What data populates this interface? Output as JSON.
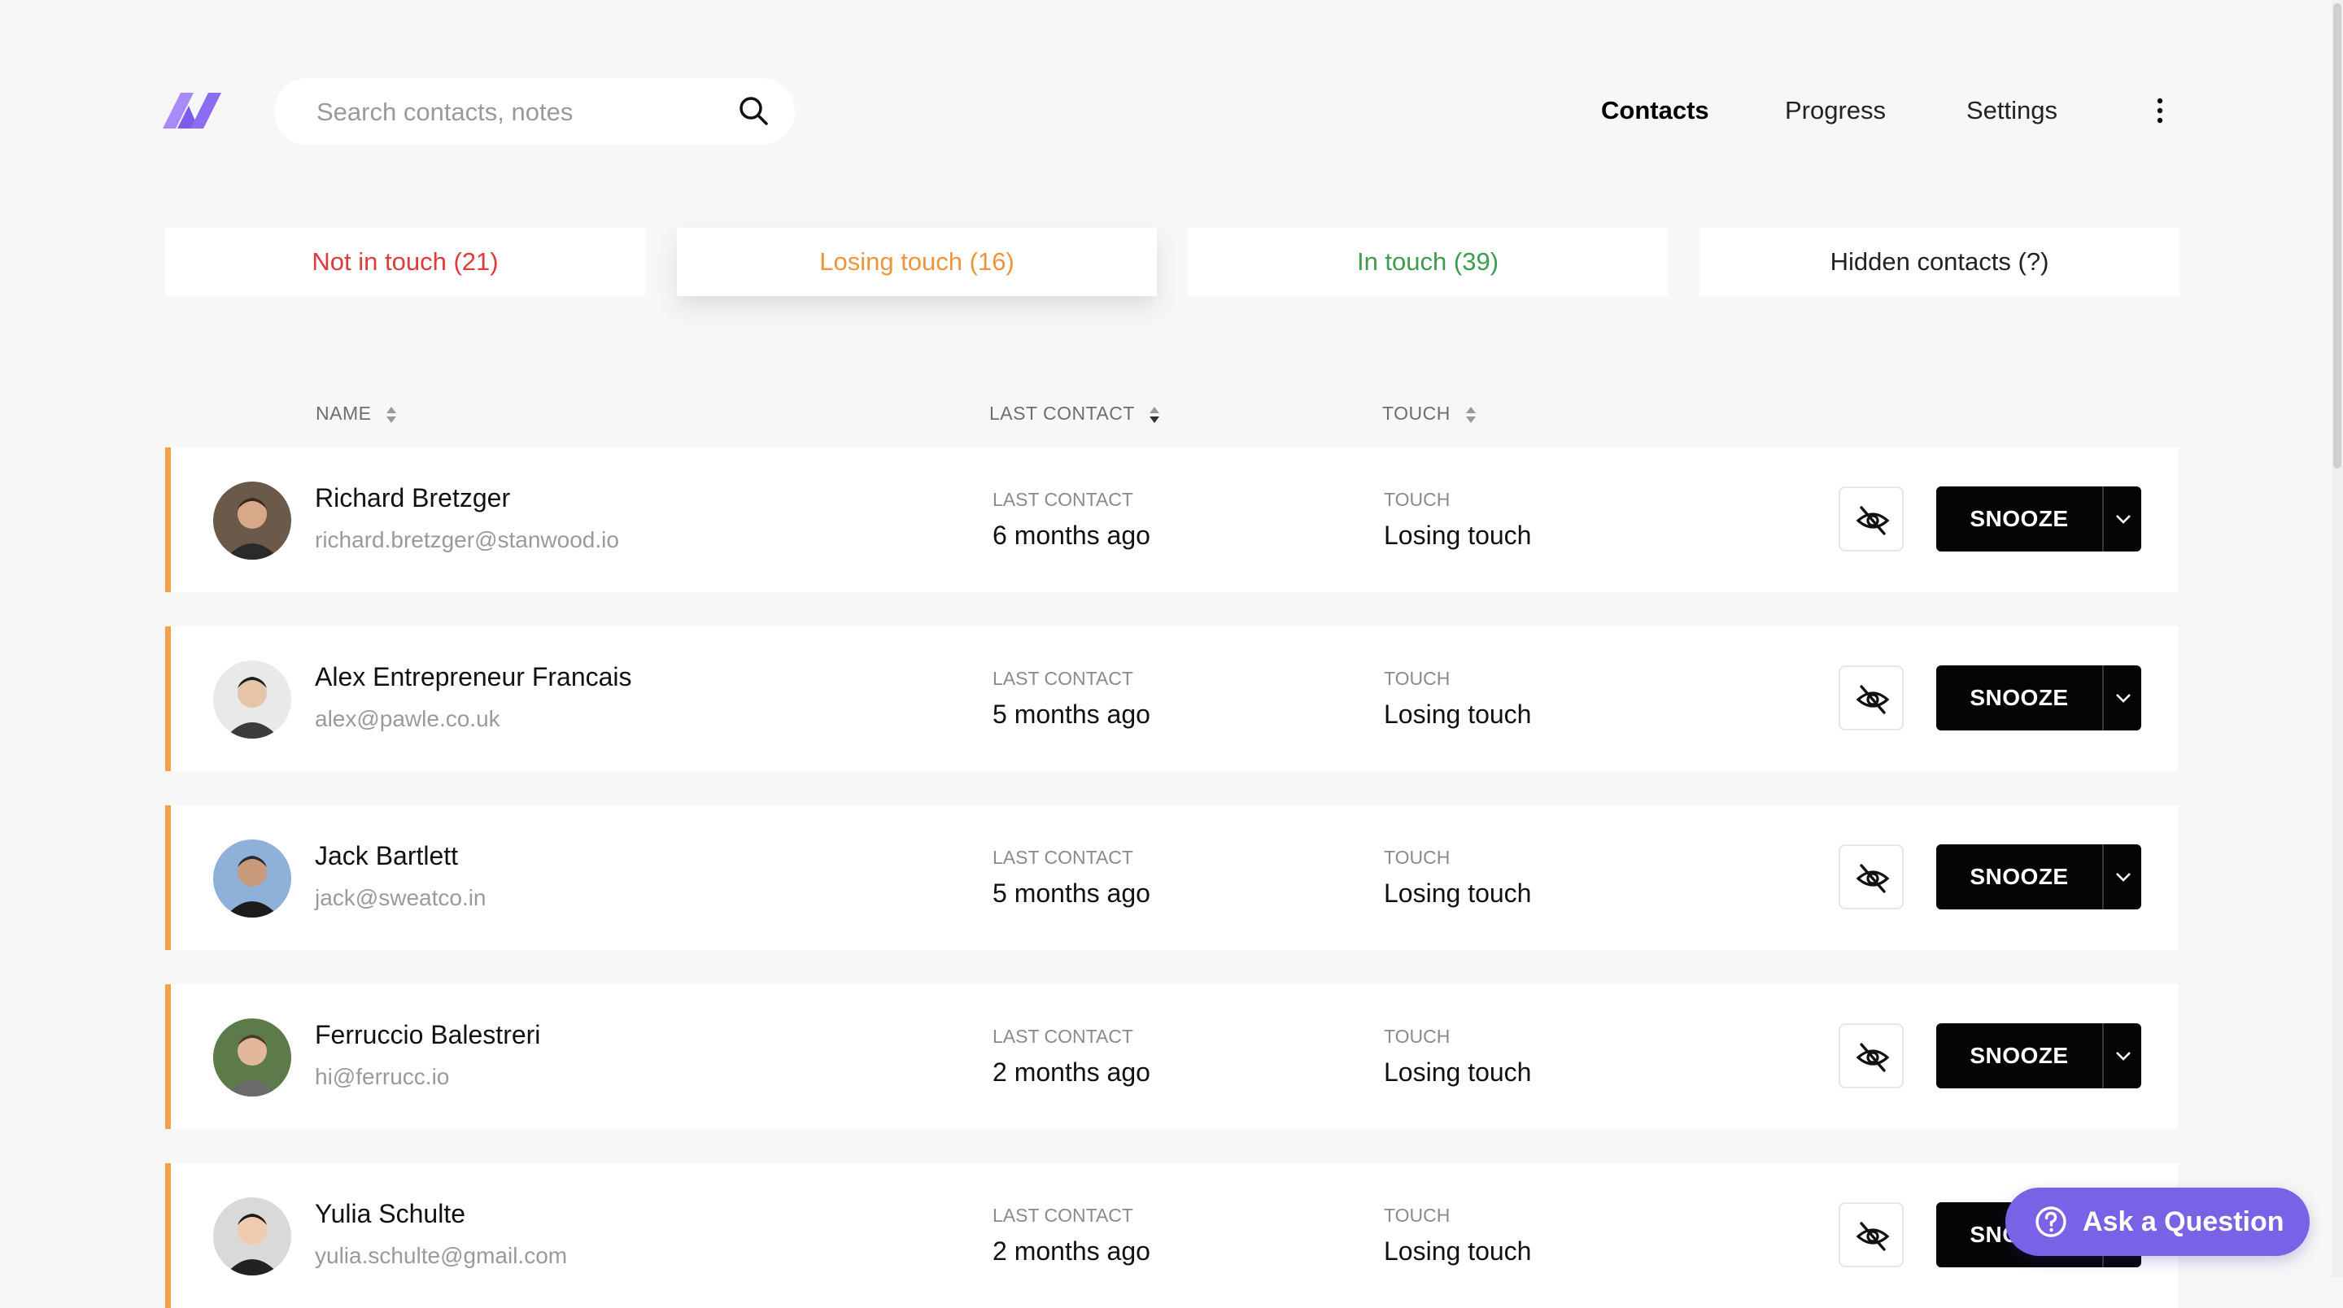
{
  "header": {
    "search_placeholder": "Search contacts, notes",
    "nav": {
      "contacts": "Contacts",
      "progress": "Progress",
      "settings": "Settings"
    },
    "active_nav": "Contacts"
  },
  "tabs": {
    "not_in_touch": "Not in touch (21)",
    "losing_touch": "Losing touch (16)",
    "in_touch": "In touch (39)",
    "hidden": "Hidden contacts (?)",
    "active": "losing_touch"
  },
  "columns": {
    "name": "NAME",
    "last_contact": "LAST CONTACT",
    "touch": "TOUCH"
  },
  "row_labels": {
    "last_contact": "LAST CONTACT",
    "touch": "TOUCH",
    "snooze": "SNOOZE"
  },
  "contacts": [
    {
      "name": "Richard Bretzger",
      "email": "richard.bretzger@stanwood.io",
      "last_contact": "6 months ago",
      "touch": "Losing touch"
    },
    {
      "name": "Alex Entrepreneur Francais",
      "email": "alex@pawle.co.uk",
      "last_contact": "5 months ago",
      "touch": "Losing touch"
    },
    {
      "name": "Jack Bartlett",
      "email": "jack@sweatco.in",
      "last_contact": "5 months ago",
      "touch": "Losing touch"
    },
    {
      "name": "Ferruccio Balestreri",
      "email": "hi@ferrucc.io",
      "last_contact": "2 months ago",
      "touch": "Losing touch"
    },
    {
      "name": "Yulia Schulte",
      "email": "yulia.schulte@gmail.com",
      "last_contact": "2 months ago",
      "touch": "Losing touch"
    }
  ],
  "ask_button": "Ask a Question",
  "colors": {
    "not_in_touch": "#e03a3a",
    "losing_touch": "#f0943c",
    "in_touch": "#3e9d4d",
    "row_accent": "#f5a04a",
    "brand": "#8b6cf0",
    "ask_bg": "#7a62e6"
  }
}
